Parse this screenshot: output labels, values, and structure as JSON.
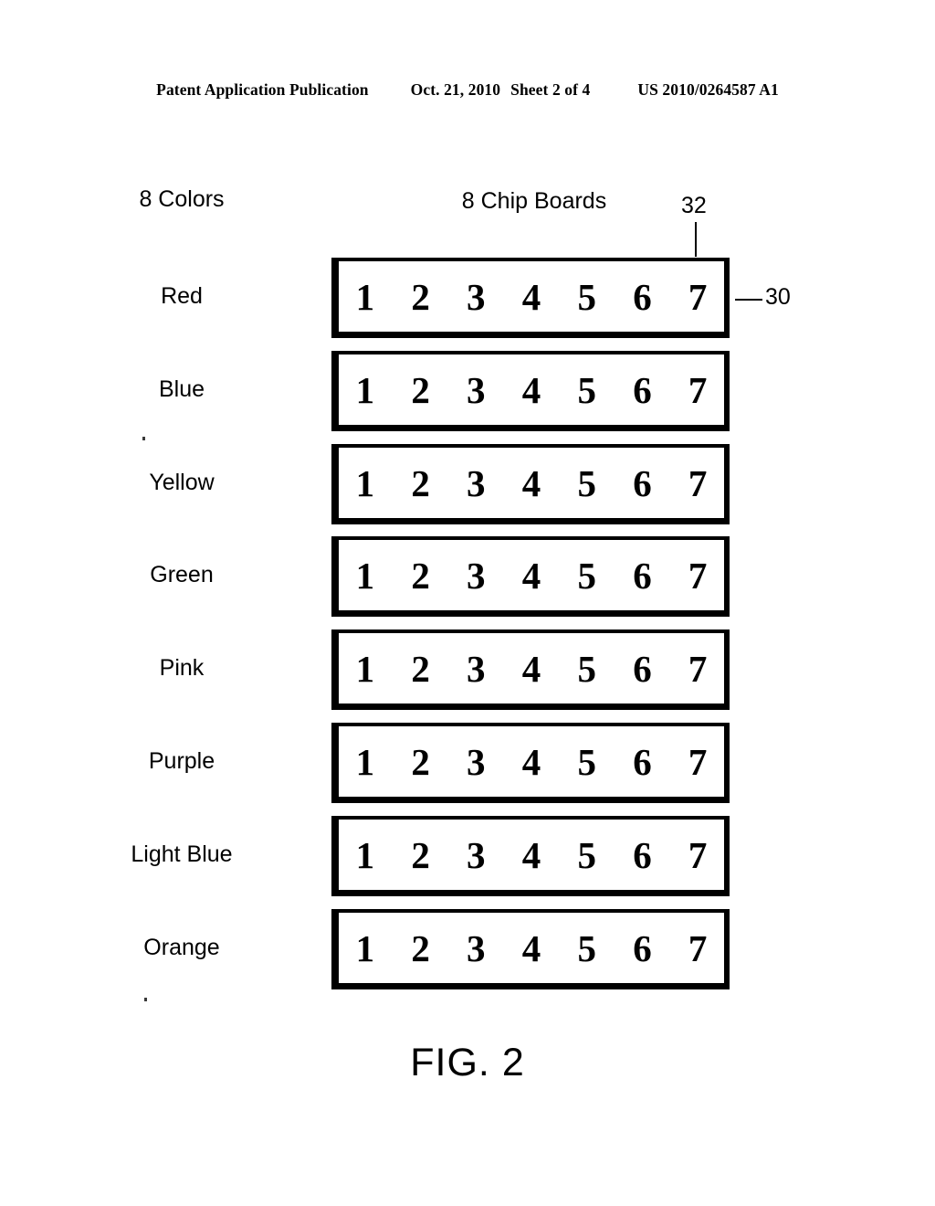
{
  "header": {
    "publication": "Patent Application Publication",
    "date": "Oct. 21, 2010",
    "sheet": "Sheet 2 of 4",
    "publication_number": "US 2010/0264587 A1"
  },
  "figure": {
    "caption": "FIG. 2",
    "colors_heading": "8 Colors",
    "boards_heading": "8 Chip Boards",
    "reference_numerals": [
      {
        "id": "32",
        "label": "32",
        "points_to": "chip-board-frame"
      },
      {
        "id": "30",
        "label": "30",
        "points_to": "chip-board"
      }
    ],
    "chip_labels": [
      "1",
      "2",
      "3",
      "4",
      "5",
      "6",
      "7"
    ],
    "boards": [
      {
        "color": "Red"
      },
      {
        "color": "Blue"
      },
      {
        "color": "Yellow"
      },
      {
        "color": "Green"
      },
      {
        "color": "Pink"
      },
      {
        "color": "Purple"
      },
      {
        "color": "Light Blue"
      },
      {
        "color": "Orange"
      }
    ],
    "colors": {
      "ink": "#000000",
      "paper": "#ffffff"
    }
  }
}
